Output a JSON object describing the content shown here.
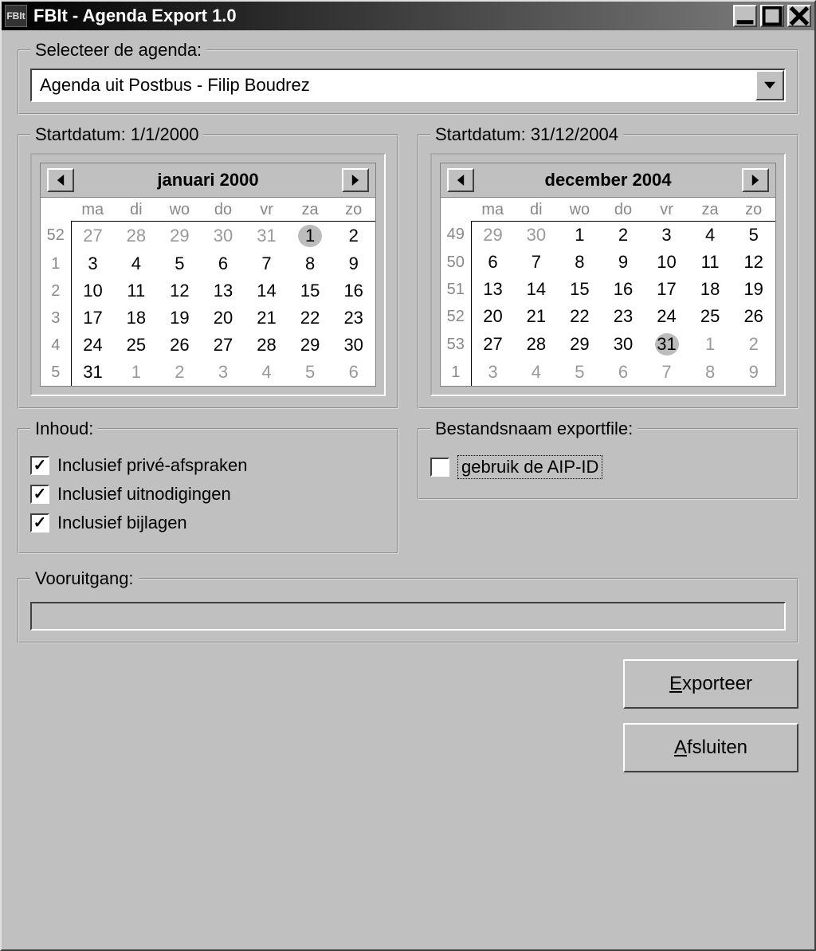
{
  "window": {
    "title": "FBIt - Agenda Export 1.0",
    "icon_text": "FBIt"
  },
  "agenda_group": {
    "legend": "Selecteer de agenda:",
    "selected": "Agenda uit Postbus - Filip Boudrez"
  },
  "start_left": {
    "legend": "Startdatum: 1/1/2000",
    "month_label": "januari 2000",
    "day_headers": [
      "ma",
      "di",
      "wo",
      "do",
      "vr",
      "za",
      "zo"
    ],
    "rows": [
      {
        "wk": "52",
        "cells": [
          {
            "v": "27",
            "o": true
          },
          {
            "v": "28",
            "o": true
          },
          {
            "v": "29",
            "o": true
          },
          {
            "v": "30",
            "o": true
          },
          {
            "v": "31",
            "o": true
          },
          {
            "v": "1",
            "sel": true
          },
          {
            "v": "2"
          }
        ]
      },
      {
        "wk": "1",
        "cells": [
          {
            "v": "3"
          },
          {
            "v": "4"
          },
          {
            "v": "5"
          },
          {
            "v": "6"
          },
          {
            "v": "7"
          },
          {
            "v": "8"
          },
          {
            "v": "9"
          }
        ]
      },
      {
        "wk": "2",
        "cells": [
          {
            "v": "10"
          },
          {
            "v": "11"
          },
          {
            "v": "12"
          },
          {
            "v": "13"
          },
          {
            "v": "14"
          },
          {
            "v": "15"
          },
          {
            "v": "16"
          }
        ]
      },
      {
        "wk": "3",
        "cells": [
          {
            "v": "17"
          },
          {
            "v": "18"
          },
          {
            "v": "19"
          },
          {
            "v": "20"
          },
          {
            "v": "21"
          },
          {
            "v": "22"
          },
          {
            "v": "23"
          }
        ]
      },
      {
        "wk": "4",
        "cells": [
          {
            "v": "24"
          },
          {
            "v": "25"
          },
          {
            "v": "26"
          },
          {
            "v": "27"
          },
          {
            "v": "28"
          },
          {
            "v": "29"
          },
          {
            "v": "30"
          }
        ]
      },
      {
        "wk": "5",
        "cells": [
          {
            "v": "31"
          },
          {
            "v": "1",
            "o": true
          },
          {
            "v": "2",
            "o": true
          },
          {
            "v": "3",
            "o": true
          },
          {
            "v": "4",
            "o": true
          },
          {
            "v": "5",
            "o": true
          },
          {
            "v": "6",
            "o": true
          }
        ]
      }
    ]
  },
  "start_right": {
    "legend": "Startdatum: 31/12/2004",
    "month_label": "december 2004",
    "day_headers": [
      "ma",
      "di",
      "wo",
      "do",
      "vr",
      "za",
      "zo"
    ],
    "rows": [
      {
        "wk": "49",
        "cells": [
          {
            "v": "29",
            "o": true
          },
          {
            "v": "30",
            "o": true
          },
          {
            "v": "1"
          },
          {
            "v": "2"
          },
          {
            "v": "3"
          },
          {
            "v": "4"
          },
          {
            "v": "5"
          }
        ]
      },
      {
        "wk": "50",
        "cells": [
          {
            "v": "6"
          },
          {
            "v": "7"
          },
          {
            "v": "8"
          },
          {
            "v": "9"
          },
          {
            "v": "10"
          },
          {
            "v": "11"
          },
          {
            "v": "12"
          }
        ]
      },
      {
        "wk": "51",
        "cells": [
          {
            "v": "13"
          },
          {
            "v": "14"
          },
          {
            "v": "15"
          },
          {
            "v": "16"
          },
          {
            "v": "17"
          },
          {
            "v": "18"
          },
          {
            "v": "19"
          }
        ]
      },
      {
        "wk": "52",
        "cells": [
          {
            "v": "20"
          },
          {
            "v": "21"
          },
          {
            "v": "22"
          },
          {
            "v": "23"
          },
          {
            "v": "24"
          },
          {
            "v": "25"
          },
          {
            "v": "26"
          }
        ]
      },
      {
        "wk": "53",
        "cells": [
          {
            "v": "27"
          },
          {
            "v": "28"
          },
          {
            "v": "29"
          },
          {
            "v": "30"
          },
          {
            "v": "31",
            "sel": true
          },
          {
            "v": "1",
            "o": true
          },
          {
            "v": "2",
            "o": true
          }
        ]
      },
      {
        "wk": "1",
        "cells": [
          {
            "v": "3",
            "o": true
          },
          {
            "v": "4",
            "o": true
          },
          {
            "v": "5",
            "o": true
          },
          {
            "v": "6",
            "o": true
          },
          {
            "v": "7",
            "o": true
          },
          {
            "v": "8",
            "o": true
          },
          {
            "v": "9",
            "o": true
          }
        ]
      }
    ]
  },
  "inhoud": {
    "legend": "Inhoud:",
    "items": [
      {
        "label": "Inclusief privé-afspraken",
        "checked": true
      },
      {
        "label": "Inclusief uitnodigingen",
        "checked": true
      },
      {
        "label": "Inclusief bijlagen",
        "checked": true
      }
    ]
  },
  "exportfile": {
    "legend": "Bestandsnaam exportfile:",
    "item": {
      "label": "gebruik de AIP-ID",
      "checked": false
    }
  },
  "progress": {
    "legend": "Vooruitgang:"
  },
  "buttons": {
    "export": {
      "ul": "E",
      "rest": "xporteer"
    },
    "close": {
      "ul": "A",
      "rest": "fsluiten"
    }
  }
}
